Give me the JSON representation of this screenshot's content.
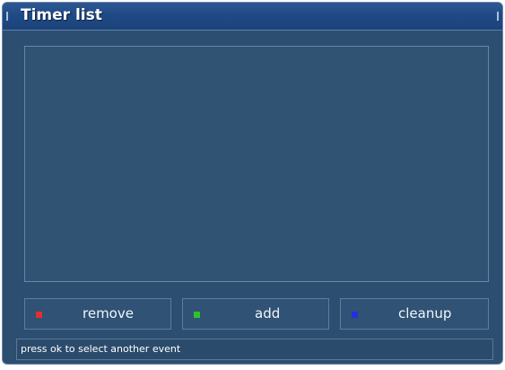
{
  "window": {
    "title": "Timer list"
  },
  "buttons": [
    {
      "label": "remove",
      "color": "#e03030",
      "icon": "red-dot-icon"
    },
    {
      "label": "add",
      "color": "#30c030",
      "icon": "green-dot-icon"
    },
    {
      "label": "cleanup",
      "color": "#2030e0",
      "icon": "blue-dot-icon"
    }
  ],
  "status": {
    "text": "press ok to select another event"
  },
  "colors": {
    "background": "#2c4e70",
    "titlebar": "#1f4a86",
    "border": "#6f88a8"
  }
}
